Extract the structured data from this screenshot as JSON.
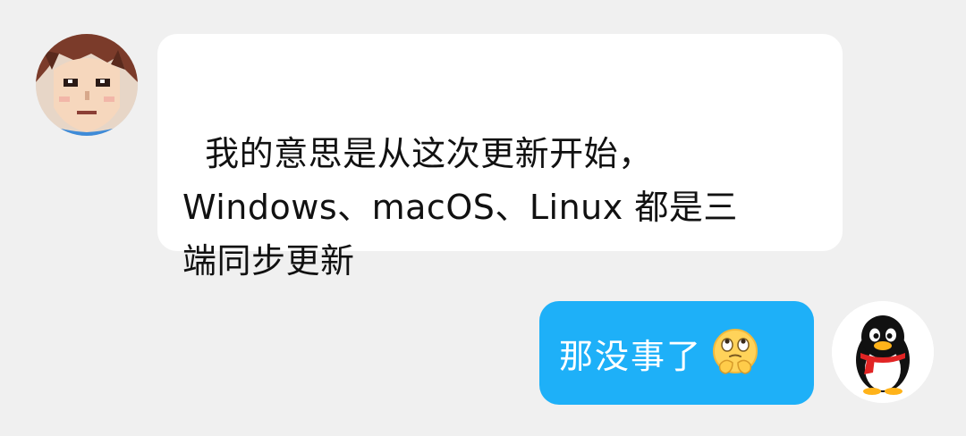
{
  "chat": {
    "incoming": {
      "text": "我的意思是从这次更新开始，\nWindows、macOS、Linux 都是三\n端同步更新",
      "avatar_icon": "anime-boy-avatar-icon",
      "bubble_color": "#ffffff"
    },
    "outgoing": {
      "text": "那没事了",
      "emoji_icon": "thinking-face-emoji-icon",
      "avatar_icon": "qq-penguin-avatar-icon",
      "bubble_color": "#1eb0f8"
    }
  },
  "colors": {
    "background": "#f0f0f0",
    "text_dark": "#111111",
    "text_light": "#ffffff"
  }
}
